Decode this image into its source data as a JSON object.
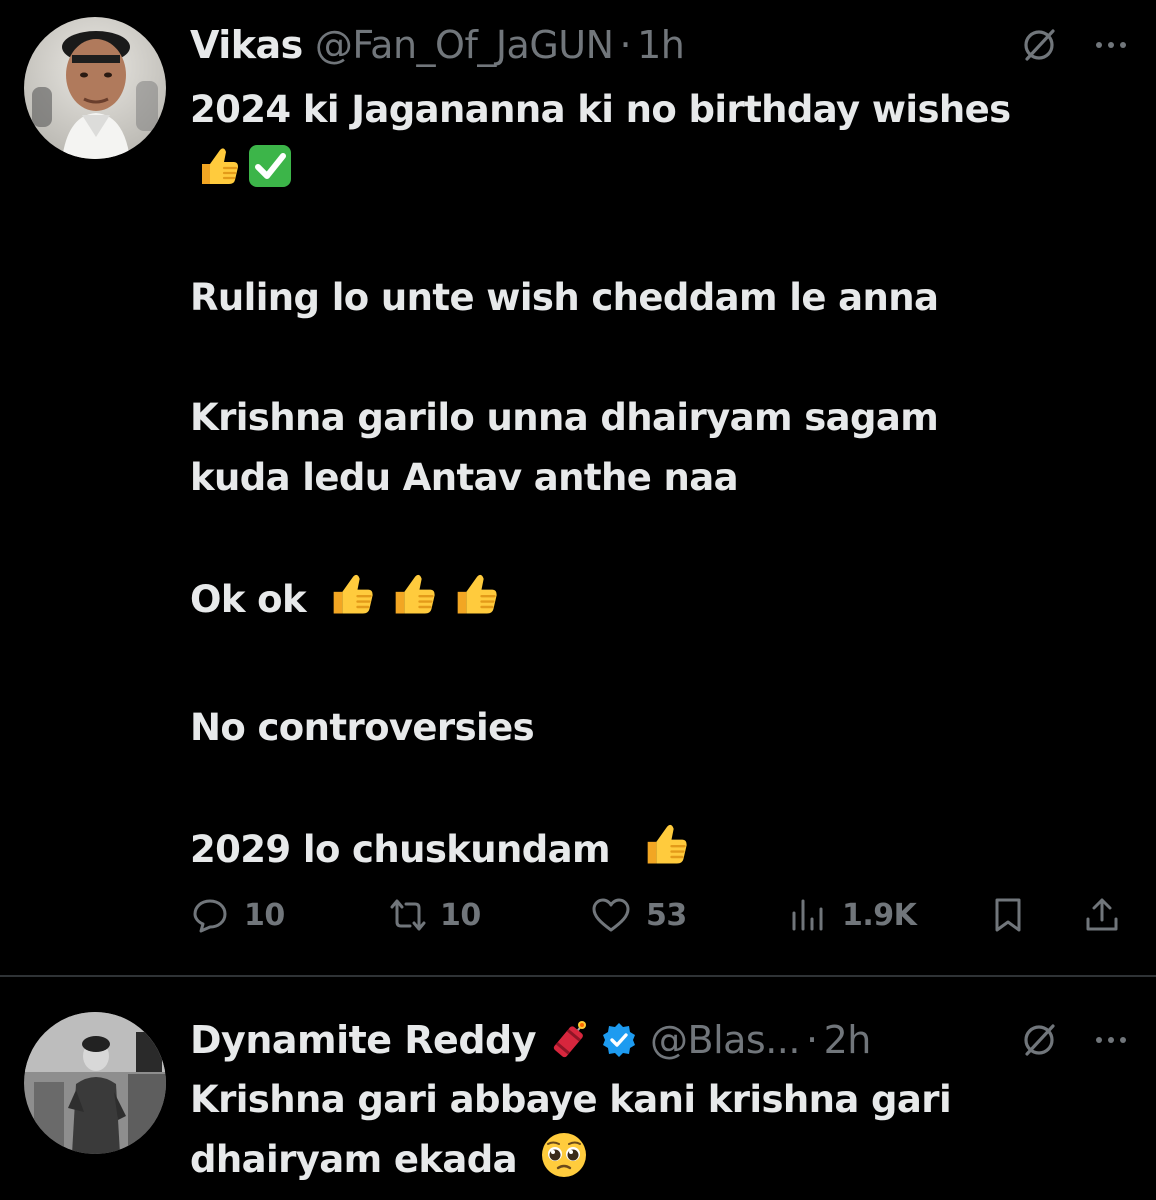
{
  "tweets": [
    {
      "author": {
        "display_name": "Vikas",
        "handle": "@Fan_Of_JaGUN",
        "separator": "·",
        "time": "1h"
      },
      "text": {
        "line1": "2024 ki Jagananna ki no birthday wishes",
        "line1_emojis": [
          "thumbs-up",
          "check-mark"
        ],
        "para2": "Ruling lo unte wish cheddam le anna",
        "para3_line1": "Krishna garilo unna dhairyam sagam",
        "para3_line2": "kuda ledu Antav anthe naa",
        "para4": "Ok ok",
        "para4_emojis": [
          "thumbs-up",
          "thumbs-up",
          "thumbs-up"
        ],
        "para5": "No controversies",
        "para6": "2029 lo chuskundam",
        "para6_emojis": [
          "thumbs-up"
        ]
      },
      "actions": {
        "replies": "10",
        "reposts": "10",
        "likes": "53",
        "views": "1.9K"
      }
    },
    {
      "author": {
        "display_name": "Dynamite Reddy",
        "name_emoji": "firecracker",
        "verified": true,
        "handle": "@Blas...",
        "separator": "·",
        "time": "2h"
      },
      "text": {
        "line1": "Krishna gari abbaye kani krishna gari",
        "line2_prefix": "dhairyam ekada",
        "line2_emoji": "pleading-face"
      }
    }
  ],
  "icons": [
    "grok-icon",
    "more-icon",
    "reply-icon",
    "repost-icon",
    "like-icon",
    "views-icon",
    "bookmark-icon",
    "share-icon",
    "verified-icon"
  ],
  "colors": {
    "background": "#000000",
    "primary_text": "#e7e9ea",
    "secondary_text": "#71767b",
    "divider": "#2f3336",
    "verified": "#1d9bf0"
  }
}
